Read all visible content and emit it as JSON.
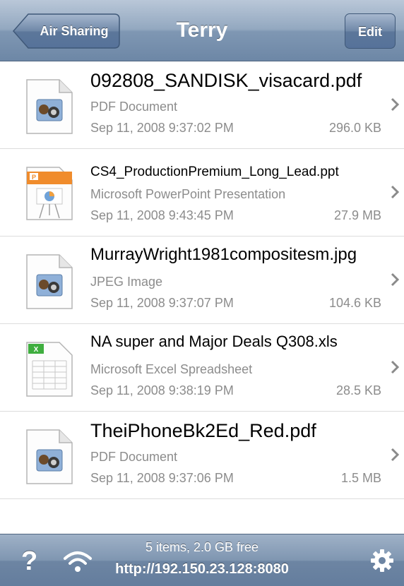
{
  "navbar": {
    "back_label": "Air Sharing",
    "title": "Terry",
    "edit_label": "Edit"
  },
  "files": [
    {
      "name": "092808_SANDISK_visacard.pdf",
      "kind": "PDF Document",
      "date": "Sep 11, 2008 9:37:02 PM",
      "size": "296.0 KB",
      "icon": "image-document-icon"
    },
    {
      "name": "CS4_ProductionPremium_Long_Lead.ppt",
      "kind": "Microsoft PowerPoint Presentation",
      "date": "Sep 11, 2008 9:43:45 PM",
      "size": "27.9 MB",
      "icon": "powerpoint-icon"
    },
    {
      "name": "MurrayWright1981compositesm.jpg",
      "kind": "JPEG Image",
      "date": "Sep 11, 2008 9:37:07 PM",
      "size": "104.6 KB",
      "icon": "image-document-icon"
    },
    {
      "name": "NA super and Major Deals  Q308.xls",
      "kind": "Microsoft Excel Spreadsheet",
      "date": "Sep 11, 2008 9:38:19 PM",
      "size": "28.5 KB",
      "icon": "excel-icon"
    },
    {
      "name": "TheiPhoneBk2Ed_Red.pdf",
      "kind": "PDF Document",
      "date": "Sep 11, 2008 9:37:06 PM",
      "size": "1.5 MB",
      "icon": "image-document-icon"
    }
  ],
  "toolbar": {
    "help_symbol": "?",
    "status_items": "5 items, 2.0 GB free",
    "server_url": "http://192.150.23.128:8080"
  },
  "colors": {
    "navbar": "#8ea3bc",
    "toolbar": "#7890ad",
    "secondary_text": "#8c8c8c"
  }
}
